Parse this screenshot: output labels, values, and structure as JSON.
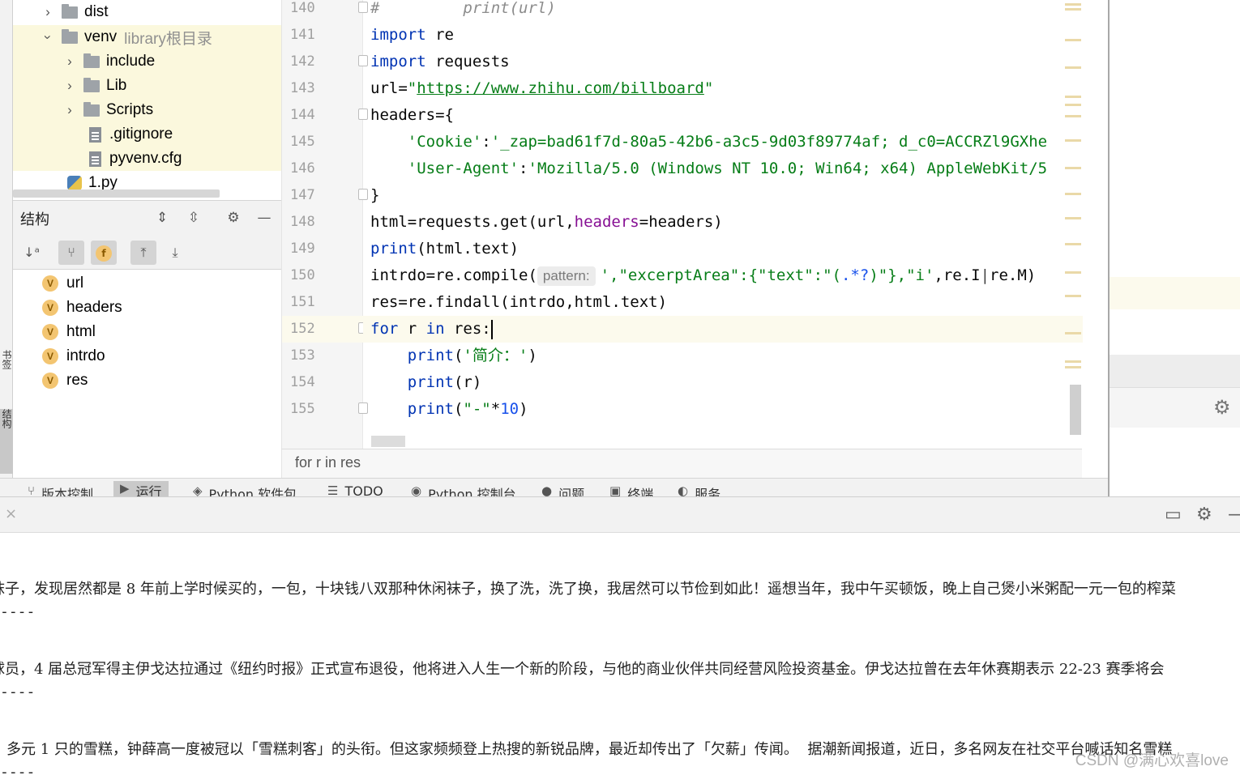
{
  "project_tree": {
    "items": [
      {
        "label": "dist",
        "sub": ""
      },
      {
        "label": "venv",
        "sub": "library根目录"
      },
      {
        "label": "include",
        "sub": ""
      },
      {
        "label": "Lib",
        "sub": ""
      },
      {
        "label": "Scripts",
        "sub": ""
      },
      {
        "label": ".gitignore",
        "sub": ""
      },
      {
        "label": "pyvenv.cfg",
        "sub": ""
      },
      {
        "label": "1.py",
        "sub": ""
      }
    ]
  },
  "left_strip": {
    "tab1": "书签",
    "tab2": "结构"
  },
  "structure": {
    "title": "结构",
    "items": [
      "url",
      "headers",
      "html",
      "intrdo",
      "res"
    ],
    "var_icon_letter": "V",
    "field_badge": "f"
  },
  "editor": {
    "line_numbers": [
      "140",
      "141",
      "142",
      "143",
      "144",
      "145",
      "146",
      "147",
      "148",
      "149",
      "150",
      "151",
      "152",
      "153",
      "154",
      "155"
    ],
    "current_line": "152",
    "param_hint": "pattern:",
    "breadcrumb": "for r in res",
    "code": {
      "l140_hash": "#",
      "l140_comment": "         print(url)",
      "l141_kw": "import",
      "l141_rest": " re",
      "l142_kw": "import",
      "l142_rest": " requests",
      "l143_a": "url=",
      "l143_q1": "\"",
      "l143_url": "https://www.zhihu.com/billboard",
      "l143_q2": "\"",
      "l144": "headers={",
      "l145_indent": "    ",
      "l145_key": "'Cookie'",
      "l145_colon": ":",
      "l145_val": "'_zap=bad61f7d-80a5-42b6-a3c5-9d03f89774af; d_c0=ACCRZl9GXhe",
      "l146_indent": "    ",
      "l146_key": "'User-Agent'",
      "l146_colon": ":",
      "l146_val": "'Mozilla/5.0 (Windows NT 10.0; Win64; x64) AppleWebKit/5",
      "l147": "}",
      "l148_a": "html=requests.get(url,",
      "l148_param": "headers",
      "l148_b": "=headers)",
      "l149_fn": "print",
      "l149_rest": "(html.text)",
      "l150_a": "intrdo=re.compile(",
      "l150_str": "',\"excerptArea\":{\"text\":\"(",
      "l150_re": ".*?",
      "l150_str2": ")\"},\"i'",
      "l150_b": ",re.I",
      "l150_c": "re.M)",
      "l151": "res=re.findall(intrdo,html.text)",
      "l152_kw": "for",
      "l152_a": " r ",
      "l152_kw2": "in",
      "l152_b": " res:",
      "l153_indent": "    ",
      "l153_fn": "print",
      "l153_a": "(",
      "l153_str": "'简介：'",
      "l153_b": ")",
      "l154_indent": "    ",
      "l154_fn": "print",
      "l154_a": "(r)",
      "l155_indent": "    ",
      "l155_fn": "print",
      "l155_a": "(",
      "l155_str": "\"-\"",
      "l155_b": "*",
      "l155_num": "10",
      "l155_c": ")"
    }
  },
  "tool_tabs": [
    {
      "icon": "branch-icon",
      "label": "版本控制"
    },
    {
      "icon": "run-icon",
      "label": "运行"
    },
    {
      "icon": "layers-icon",
      "label": "Python 软件包"
    },
    {
      "icon": "list-icon",
      "label": "TODO"
    },
    {
      "icon": "python-console-icon",
      "label": "Python 控制台"
    },
    {
      "icon": "info-icon",
      "label": "问题"
    },
    {
      "icon": "terminal-icon",
      "label": "终端"
    },
    {
      "icon": "services-icon",
      "label": "服务"
    }
  ],
  "console": {
    "lines": [
      {
        "kind": "sep",
        "text": "----"
      },
      {
        "kind": "text",
        "text": "袜子，发现居然都是 8 年前上学时候买的，一包，十块钱八双那种休闲袜子，换了洗，洗了换，我居然可以节俭到如此！遥想当年，我中午买顿饭，晚上自己煲小米粥配一元一包的榨菜"
      },
      {
        "kind": "sep",
        "text": "----"
      },
      {
        "kind": "text",
        "text": "球员，4 届总冠军得主伊戈达拉通过《纽约时报》正式宣布退役，他将进入人生一个新的阶段，与他的商业伙伴共同经营风险投资基金。伊戈达拉曾在去年休赛期表示 22-23 赛季将会"
      },
      {
        "kind": "sep",
        "text": "----"
      },
      {
        "kind": "text",
        "text": "多元 1 只的雪糕，钟薛高一度被冠以「雪糕刺客」的头衔。但这家频频登上热搜的新锐品牌，最近却传出了「欠薪」传闻。  据潮新闻报道，近日，多名网友在社交平台喊话知名雪糕"
      },
      {
        "kind": "sep",
        "text": "----"
      }
    ]
  },
  "watermark": "CSDN @满心欢喜love",
  "colors": {
    "keyword": "#0033b3",
    "string": "#067d17",
    "number": "#1750eb",
    "current_line": "#fcfaed",
    "tree_highlight": "#fbf8dd"
  }
}
